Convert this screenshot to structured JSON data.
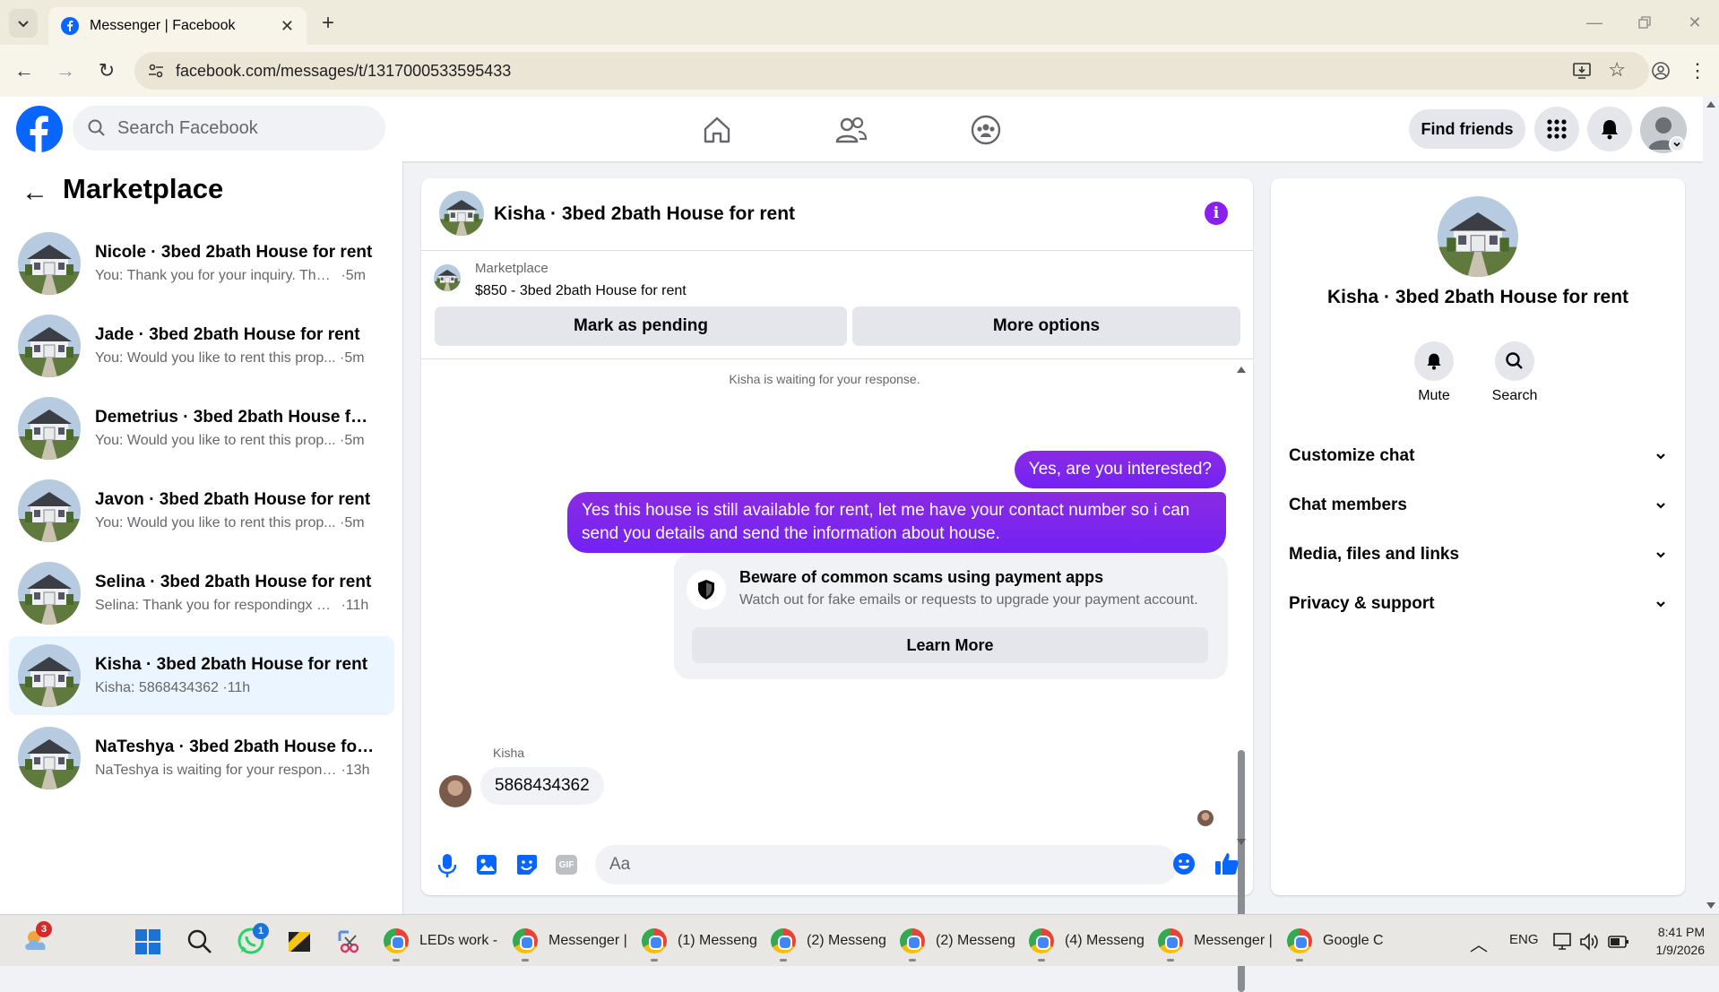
{
  "browser": {
    "tab_title": "Messenger | Facebook",
    "url": "facebook.com/messages/t/1317000533595433"
  },
  "header": {
    "search_placeholder": "Search Facebook",
    "find_friends": "Find friends"
  },
  "sidebar": {
    "title": "Marketplace",
    "conversations": [
      {
        "name": "Nicole · 3bed 2bath House for rent",
        "preview": "You: Thank you for your inquiry. The ...",
        "time": "5m",
        "active": false
      },
      {
        "name": "Jade · 3bed 2bath House for rent",
        "preview": "You: Would you like to rent this prop...",
        "time": "5m",
        "active": false
      },
      {
        "name": "Demetrius · 3bed 2bath House for ...",
        "preview": "You: Would you like to rent this prop...",
        "time": "5m",
        "active": false
      },
      {
        "name": "Javon · 3bed 2bath House for rent",
        "preview": "You: Would you like to rent this prop...",
        "time": "5m",
        "active": false
      },
      {
        "name": "Selina · 3bed 2bath House for rent",
        "preview": "Selina: Thank you for respondingx m...",
        "time": "11h",
        "active": false
      },
      {
        "name": "Kisha · 3bed 2bath House for rent",
        "preview": "Kisha: 5868434362",
        "time": "11h",
        "active": true
      },
      {
        "name": "NaTeshya · 3bed 2bath House for r...",
        "preview": "NaTeshya is waiting for your response.",
        "time": "13h",
        "active": false
      }
    ]
  },
  "chat": {
    "title": "Kisha · 3bed 2bath House for rent",
    "listing_source": "Marketplace",
    "listing_title": "$850 - 3bed 2bath House for rent",
    "mark_pending": "Mark as pending",
    "more_options": "More options",
    "waiting_notice": "Kisha is waiting for your response.",
    "messages": [
      {
        "from": "me",
        "text": "Yes, are you interested?"
      },
      {
        "from": "me",
        "text": "Yes this house is still available for rent, let me have your contact number so i can send you details and send the information about house."
      }
    ],
    "scam_title": "Beware of common scams using payment apps",
    "scam_body": "Watch out for fake emails or requests to upgrade your payment account.",
    "learn_more": "Learn More",
    "other_name": "Kisha",
    "other_message": "5868434362",
    "composer_placeholder": "Aa"
  },
  "details": {
    "title": "Kisha · 3bed 2bath House for rent",
    "mute": "Mute",
    "search": "Search",
    "sections": [
      "Customize chat",
      "Chat members",
      "Media, files and links",
      "Privacy & support"
    ]
  },
  "taskbar": {
    "apps": [
      {
        "label": "LEDs work -"
      },
      {
        "label": "Messenger |"
      },
      {
        "label": "(1) Messeng"
      },
      {
        "label": "(2) Messeng"
      },
      {
        "label": "(2) Messeng"
      },
      {
        "label": "(4) Messeng"
      },
      {
        "label": "Messenger |"
      },
      {
        "label": "Google C"
      }
    ],
    "weather_badge": "3",
    "whatsapp_badge": "1",
    "lang": "ENG",
    "time": "8:41 PM",
    "date": "1/9/2026"
  },
  "colors": {
    "fb_blue": "#0866ff",
    "accent_purple": "#7322f5",
    "active_row": "#ebf5ff"
  }
}
